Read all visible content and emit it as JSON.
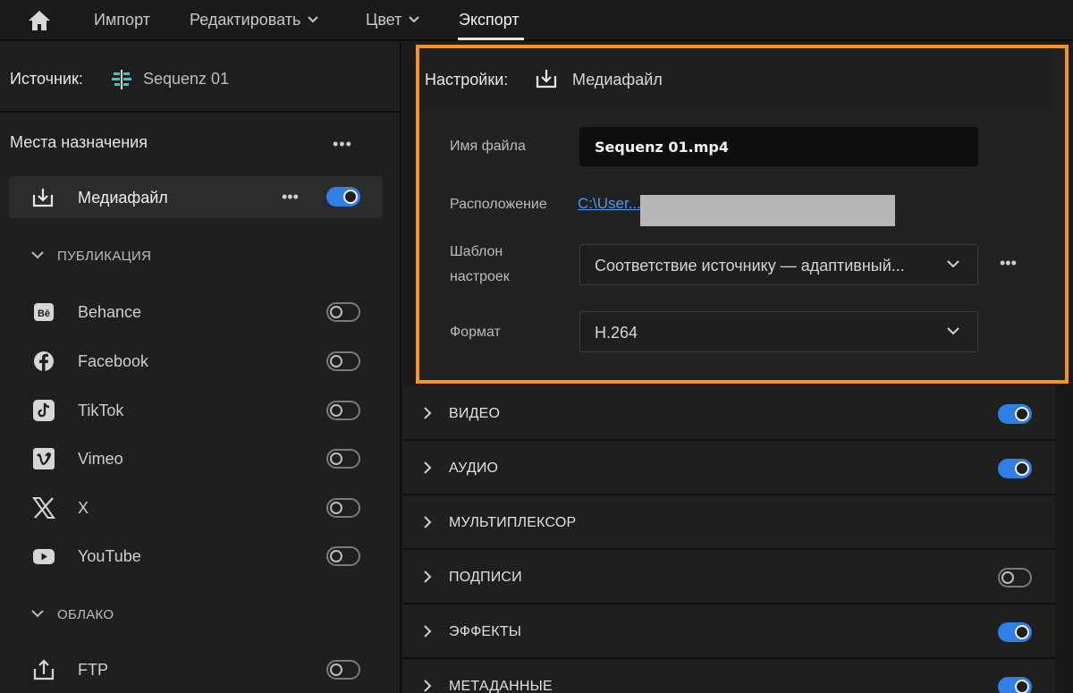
{
  "nav": {
    "items": [
      {
        "label": "Импорт"
      },
      {
        "label": "Редактировать"
      },
      {
        "label": "Цвет"
      },
      {
        "label": "Экспорт"
      }
    ]
  },
  "source": {
    "label": "Источник:",
    "value": "Sequenz 01"
  },
  "destinations": {
    "title": "Места назначения",
    "more": "•••",
    "media_file": {
      "label": "Медиафайл",
      "more": "•••",
      "enabled": true
    },
    "publication": {
      "header": "ПУБЛИКАЦИЯ",
      "items": [
        {
          "label": "Behance",
          "icon": "behance-icon",
          "enabled": false
        },
        {
          "label": "Facebook",
          "icon": "facebook-icon",
          "enabled": false
        },
        {
          "label": "TikTok",
          "icon": "tiktok-icon",
          "enabled": false
        },
        {
          "label": "Vimeo",
          "icon": "vimeo-icon",
          "enabled": false
        },
        {
          "label": "X",
          "icon": "x-icon",
          "enabled": false
        },
        {
          "label": "YouTube",
          "icon": "youtube-icon",
          "enabled": false
        }
      ]
    },
    "cloud": {
      "header": "ОБЛАКО",
      "items": [
        {
          "label": "FTP",
          "icon": "ftp-upload-icon",
          "enabled": false
        }
      ]
    }
  },
  "settings": {
    "label": "Настройки:",
    "target": "Медиафайл",
    "file_name": {
      "label": "Имя файла",
      "value": "Sequenz 01.mp4"
    },
    "location": {
      "label": "Расположение",
      "value": "C:\\User...\\"
    },
    "preset": {
      "label_line1": "Шаблон",
      "label_line2": "настроек",
      "value": "Соответствие источнику — адаптивный...",
      "more": "•••"
    },
    "format": {
      "label": "Формат",
      "value": "H.264"
    }
  },
  "sections": [
    {
      "label": "ВИДЕО",
      "toggle": "on"
    },
    {
      "label": "АУДИО",
      "toggle": "on"
    },
    {
      "label": "МУЛЬТИПЛЕКСОР",
      "toggle": "none"
    },
    {
      "label": "ПОДПИСИ",
      "toggle": "off"
    },
    {
      "label": "ЭФФЕКТЫ",
      "toggle": "on"
    },
    {
      "label": "МЕТАДАННЫЕ",
      "toggle": "on"
    }
  ],
  "colors": {
    "accent_toggle": "#2f7fe6",
    "highlight_frame": "#f7931e",
    "link": "#4a9cf0"
  }
}
